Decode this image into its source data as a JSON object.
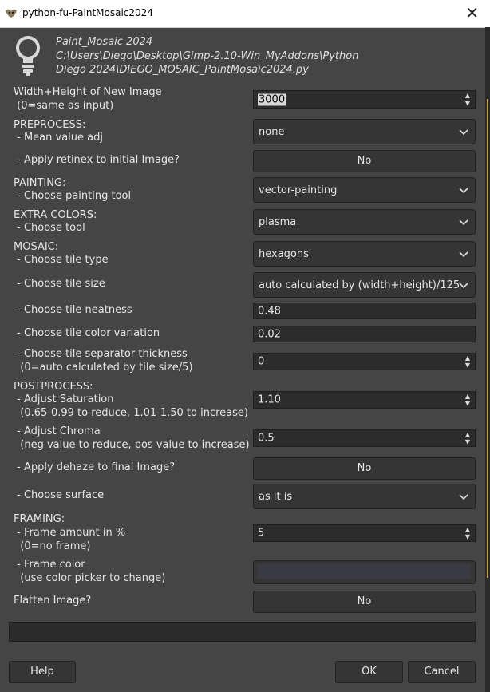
{
  "window": {
    "title": "python-fu-PaintMosaic2024",
    "close_glyph": "✕"
  },
  "header": {
    "line1": "Paint_Mosaic 2024",
    "line2": "C:\\Users\\Diego\\Desktop\\Gimp-2.10-Win_MyAddons\\Python",
    "line3": "Diego 2024\\DIEGO_MOSAIC_PaintMosaic2024.py"
  },
  "fields": {
    "width_height": {
      "label1": "Width+Height of New Image",
      "label2": " (0=same as input)",
      "value": "3000"
    },
    "preprocess": {
      "label1": "PREPROCESS:",
      "label2": " - Mean value adj",
      "value": "none"
    },
    "retinex": {
      "label": " - Apply retinex to initial Image?",
      "value": "No"
    },
    "painting": {
      "label1": "PAINTING:",
      "label2": " - Choose painting tool",
      "value": "vector-painting"
    },
    "extra_colors": {
      "label1": "EXTRA COLORS:",
      "label2": " - Choose tool",
      "value": "plasma"
    },
    "mosaic": {
      "label1": "MOSAIC:",
      "label2": " - Choose tile type",
      "value": "hexagons"
    },
    "tile_size": {
      "label": " - Choose tile size",
      "value": "auto calculated by (width+height)/125"
    },
    "tile_neatness": {
      "label": " - Choose tile neatness",
      "value": "0.48"
    },
    "tile_color_var": {
      "label": " - Choose tile color variation",
      "value": "0.02"
    },
    "tile_sep": {
      "label1": " - Choose tile separator thickness",
      "label2": "  (0=auto calculated by tile size/5)",
      "value": "0"
    },
    "saturation": {
      "label1": "POSTPROCESS:",
      "label2": " - Adjust Saturation",
      "label3": "  (0.65-0.99 to reduce, 1.01-1.50 to increase)",
      "value": "1.10"
    },
    "chroma": {
      "label1": " - Adjust Chroma",
      "label2": "  (neg value to reduce, pos value to increase)",
      "value": "0.5"
    },
    "dehaze": {
      "label": " - Apply dehaze to final Image?",
      "value": "No"
    },
    "surface": {
      "label": " - Choose surface",
      "value": "as it is"
    },
    "frame_amount": {
      "label1": "FRAMING:",
      "label2": " - Frame amount in %",
      "label3": "  (0=no frame)",
      "value": "5"
    },
    "frame_color": {
      "label1": " - Frame color",
      "label2": "  (use color picker to change)",
      "color": "#3a3a44"
    },
    "flatten": {
      "label": "Flatten Image?",
      "value": "No"
    }
  },
  "buttons": {
    "help": "Help",
    "ok": "OK",
    "cancel": "Cancel"
  },
  "colors": {
    "background": "#454545",
    "field": "#2c2c2c",
    "button": "#353535"
  }
}
